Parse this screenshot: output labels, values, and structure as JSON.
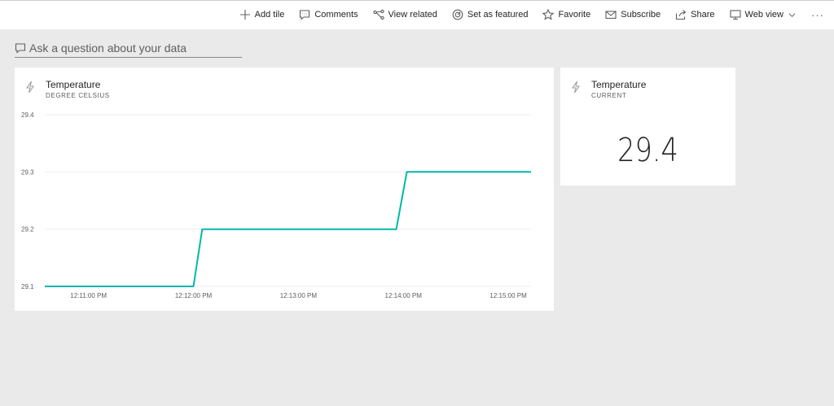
{
  "toolbar": {
    "items": [
      {
        "label": "Add tile",
        "icon": "plus-icon"
      },
      {
        "label": "Comments",
        "icon": "comment-icon"
      },
      {
        "label": "View related",
        "icon": "related-icon"
      },
      {
        "label": "Set as featured",
        "icon": "featured-icon"
      },
      {
        "label": "Favorite",
        "icon": "star-icon"
      },
      {
        "label": "Subscribe",
        "icon": "mail-icon"
      },
      {
        "label": "Share",
        "icon": "share-icon"
      },
      {
        "label": "Web view",
        "icon": "monitor-icon"
      }
    ],
    "more": "···"
  },
  "qa": {
    "placeholder": "Ask a question about your data"
  },
  "chart_tile": {
    "title": "Temperature",
    "subtitle": "DEGREE CELSIUS"
  },
  "card_tile": {
    "title": "Temperature",
    "subtitle": "CURRENT",
    "value": "29.4"
  },
  "chart_data": {
    "type": "line",
    "title": "Temperature",
    "subtitle": "DEGREE CELSIUS",
    "x_ticks": [
      "12:11:00 PM",
      "12:12:00 PM",
      "12:13:00 PM",
      "12:14:00 PM",
      "12:15:00 PM"
    ],
    "y_ticks": [
      29.1,
      29.2,
      29.3,
      29.4
    ],
    "ylim": [
      29.1,
      29.4
    ],
    "xlim": [
      "12:10:35 PM",
      "12:15:13 PM"
    ],
    "grid": true,
    "series": [
      {
        "color": "#01b8aa",
        "x": [
          "12:10:35 PM",
          "12:12:00 PM",
          "12:12:05 PM",
          "12:13:56 PM",
          "12:14:02 PM",
          "12:15:13 PM"
        ],
        "values": [
          29.1,
          29.1,
          29.2,
          29.2,
          29.3,
          29.3
        ]
      }
    ]
  }
}
